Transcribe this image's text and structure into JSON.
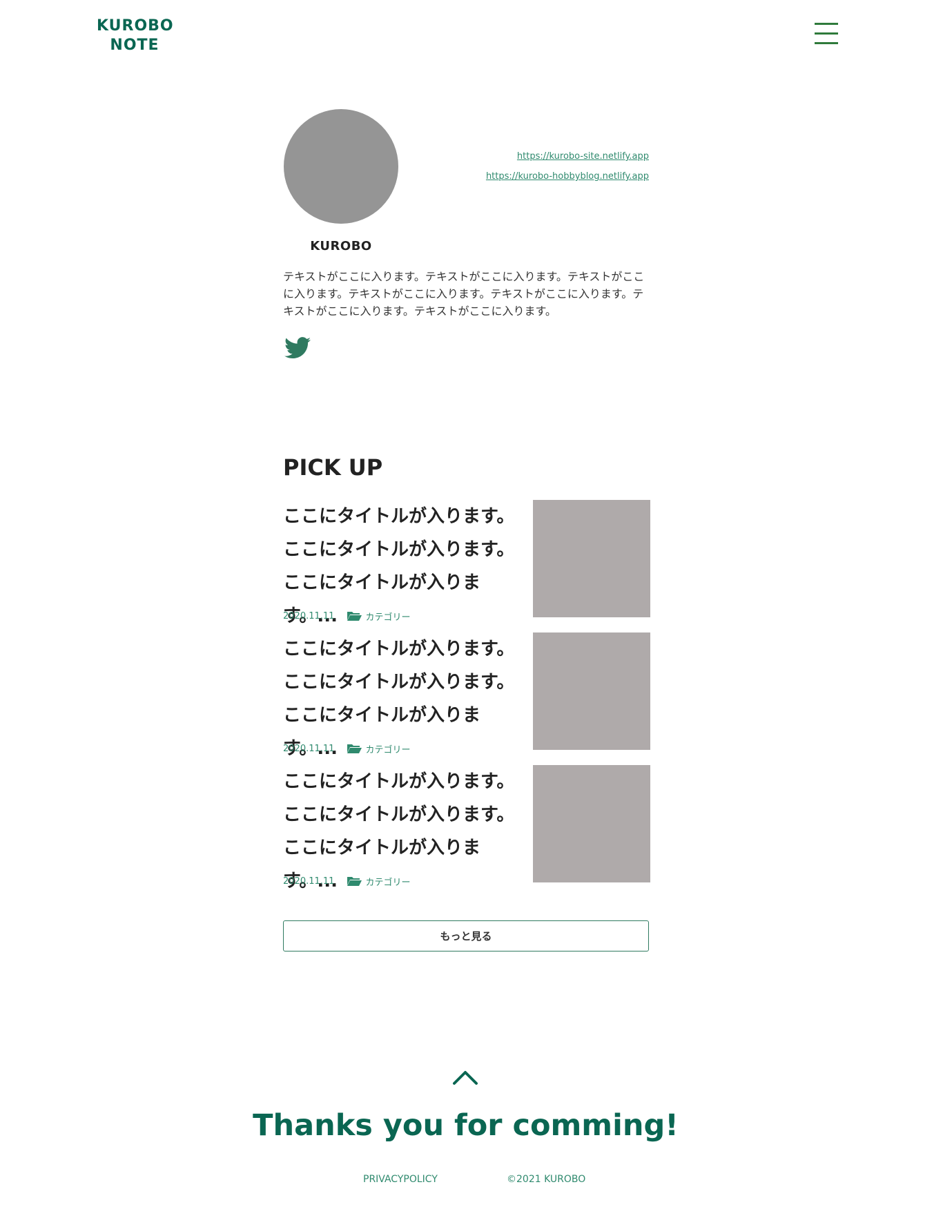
{
  "header": {
    "logo_line1": "KUROBO",
    "logo_line2": "NOTE",
    "menu_icon": "hamburger-menu-icon"
  },
  "profile": {
    "name": "KUROBO",
    "links": [
      "https://kurobo-site.netlify.app",
      "https://kurobo-hobbyblog.netlify.app"
    ],
    "bio": "テキストがここに入ります。テキストがここに入ります。テキストがここに入ります。テキストがここに入ります。テキストがここに入ります。テキストがここに入ります。テキストがここに入ります。",
    "social_icon": "twitter-icon"
  },
  "pickup": {
    "title": "PICK UP",
    "posts": [
      {
        "title": "ここにタイトルが入ります。ここにタイトルが入ります。ここにタイトルが入ります。...",
        "date": "2020.11.11",
        "category": "カテゴリー"
      },
      {
        "title": "ここにタイトルが入ります。ここにタイトルが入ります。ここにタイトルが入ります。...",
        "date": "2020.11.11",
        "category": "カテゴリー"
      },
      {
        "title": "ここにタイトルが入ります。ここにタイトルが入ります。ここにタイトルが入ります。...",
        "date": "2020.11.11",
        "category": "カテゴリー"
      }
    ],
    "more_label": "もっと見る"
  },
  "footer": {
    "to_top_icon": "chevron-up-icon",
    "thanks": "Thanks you for comming!",
    "privacy": "PRIVACYPOLICY",
    "copyright": "©2021 KUROBO"
  },
  "colors": {
    "brand": "#0a6652",
    "accent": "#2f8a6e",
    "menu": "#2f7a3b",
    "placeholder_avatar": "#959595",
    "placeholder_thumb": "#afaaaa"
  }
}
